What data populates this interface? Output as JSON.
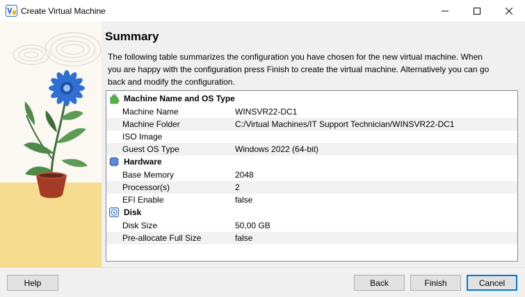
{
  "window": {
    "title": "Create Virtual Machine",
    "controls": {
      "minimize": "minimize-icon",
      "maximize": "maximize-icon",
      "close": "close-icon"
    }
  },
  "summary": {
    "heading": "Summary",
    "description": "The following table summarizes the configuration you have chosen for the new virtual machine. When you are happy with the configuration press Finish to create the virtual machine. Alternatively you can go back and modify the configuration."
  },
  "sections": {
    "name_os": {
      "title": "Machine Name and OS Type",
      "icon": "puzzle-icon",
      "rows": [
        {
          "key": "Machine Name",
          "value": "WINSVR22-DC1"
        },
        {
          "key": "Machine Folder",
          "value": "C:/Virtual Machines/IT Support Technician/WINSVR22-DC1"
        },
        {
          "key": "ISO Image",
          "value": ""
        },
        {
          "key": "Guest OS Type",
          "value": "Windows 2022 (64-bit)"
        }
      ]
    },
    "hardware": {
      "title": "Hardware",
      "icon": "chip-icon",
      "rows": [
        {
          "key": "Base Memory",
          "value": "2048"
        },
        {
          "key": "Processor(s)",
          "value": "2"
        },
        {
          "key": "EFI Enable",
          "value": "false"
        }
      ]
    },
    "disk": {
      "title": "Disk",
      "icon": "disk-icon",
      "rows": [
        {
          "key": "Disk Size",
          "value": "50,00 GB"
        },
        {
          "key": "Pre-allocate Full Size",
          "value": "false"
        }
      ]
    }
  },
  "buttons": {
    "help": "Help",
    "back": "Back",
    "finish": "Finish",
    "cancel": "Cancel"
  },
  "colors": {
    "accent": "#0078d7",
    "sidebar_floor": "#f6dc8e",
    "flower": "#2f6fd1",
    "pot": "#a33b26"
  }
}
